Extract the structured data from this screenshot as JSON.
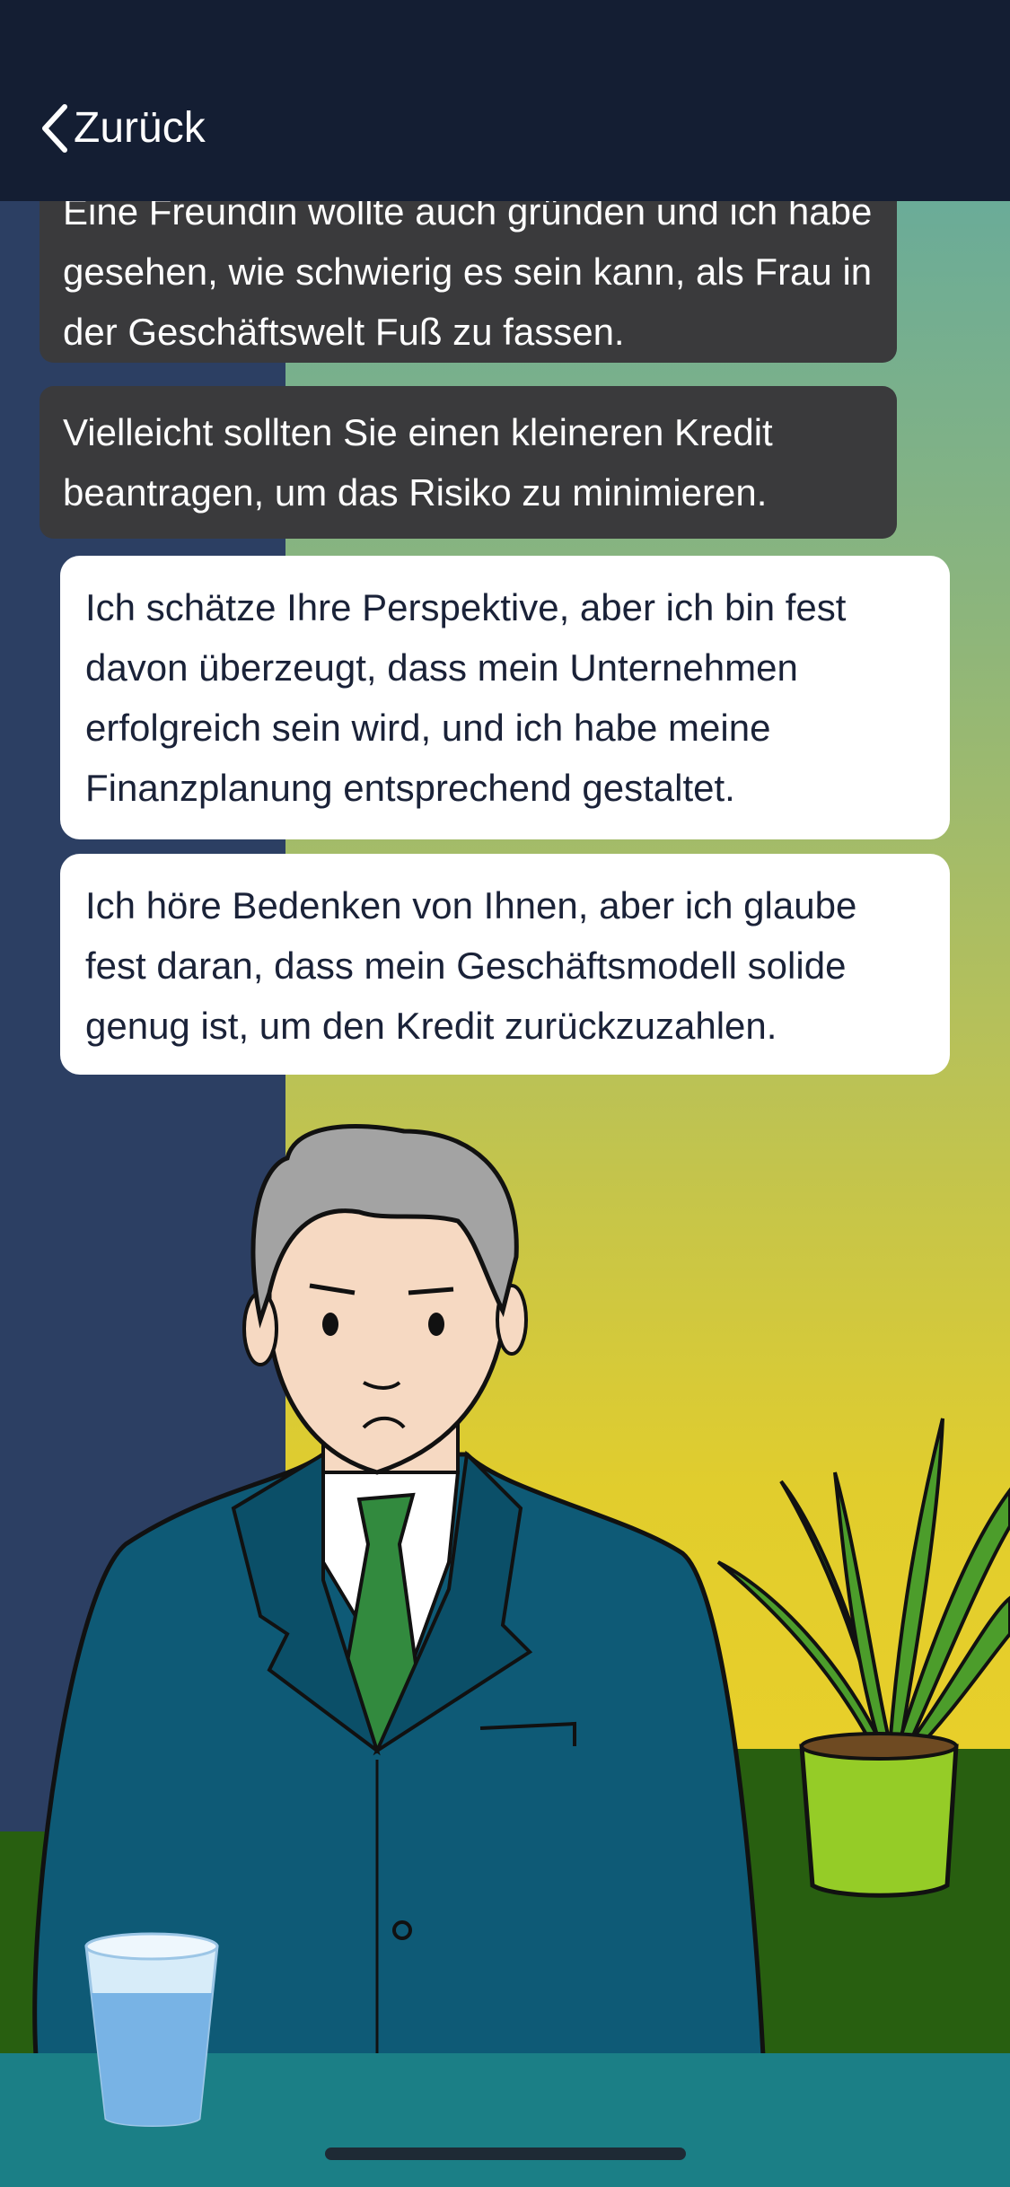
{
  "header": {
    "back_label": "Zurück"
  },
  "chat": {
    "npc_messages": [
      "Eine Freundin wollte auch gründen und ich habe gesehen, wie schwierig es sein kann, als Frau in der Geschäftswelt Fuß zu fassen.",
      "Vielleicht sollten Sie einen kleineren Kredit beantragen, um das Risiko zu minimieren."
    ],
    "choices": [
      "Ich schätze Ihre Perspektive, aber ich bin fest davon überzeugt, dass mein Unternehmen erfolgreich sein wird, und ich habe meine Finanzplanung entsprechend gestaltet.",
      "Ich höre Bedenken von Ihnen, aber ich glaube fest daran, dass mein Geschäftsmodell solide genug ist, um den Kredit zurückzuzahlen."
    ]
  },
  "colors": {
    "header_bg": "#141e33",
    "npc_bubble": "#3a3a3c",
    "choice_bubble": "#ffffff",
    "wall_left": "#2c3f63",
    "desk": "#1b7f86"
  }
}
